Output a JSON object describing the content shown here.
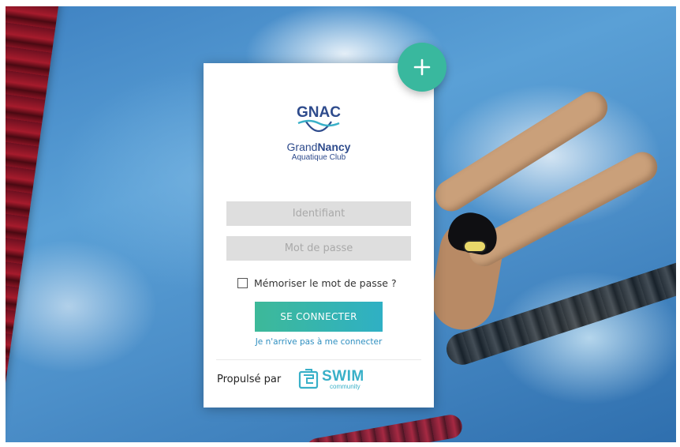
{
  "club": {
    "acronym": "GNAC",
    "name_light": "Grand",
    "name_bold": "Nancy",
    "subtitle": "Aquatique Club"
  },
  "login": {
    "username_placeholder": "Identifiant",
    "password_placeholder": "Mot de passe",
    "remember_label": "Mémoriser le mot de passe ?",
    "submit_label": "SE CONNECTER",
    "forgot_label": "Je n'arrive pas à me connecter"
  },
  "footer": {
    "powered_by": "Propulsé par",
    "brand_word": "SWIM",
    "brand_sub": "community"
  },
  "icons": {
    "fab": "plus-icon",
    "brand": "swim-community-icon"
  },
  "colors": {
    "accent": "#39b89e",
    "button_start": "#3db999",
    "button_end": "#2fb0c4",
    "link": "#2f8fc0",
    "club_blue": "#2e4b8c",
    "input_bg": "#dedede"
  }
}
